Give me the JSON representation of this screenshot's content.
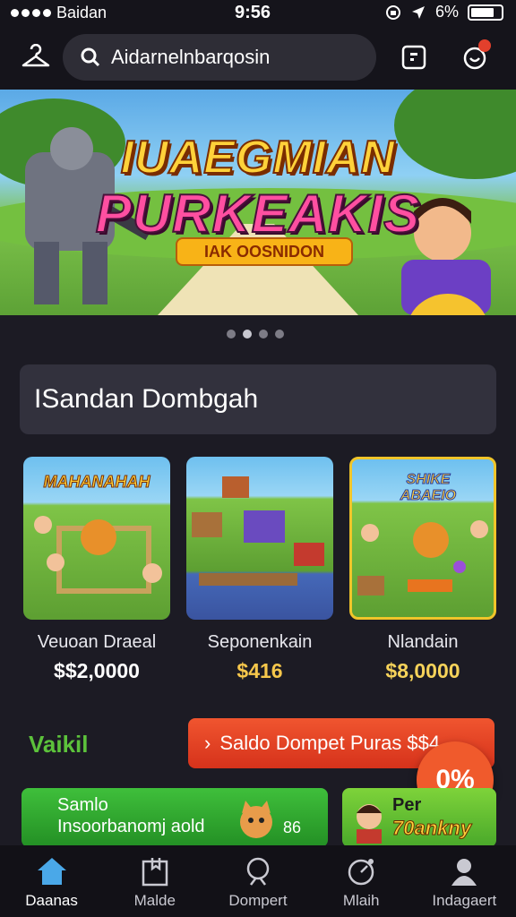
{
  "status_bar": {
    "carrier": "Baidan",
    "time": "9:56",
    "battery": "6%"
  },
  "header": {
    "search_placeholder": "Aidarnelnbarqosin"
  },
  "banner": {
    "title_line1": "IUAEGMIAN",
    "title_line2": "PURKEAKIS",
    "cta_label": "IAK OOSNIDON",
    "slides": 4,
    "active_slide": 2
  },
  "section": {
    "title": "ISandan Dombgah"
  },
  "games": [
    {
      "thumb_title": "MAHANAHAH",
      "name": "Veuoan Draeal",
      "price": "$$2,0000",
      "price_color": "#ffffff"
    },
    {
      "thumb_title": "",
      "name": "Seponenkain",
      "price": "$416",
      "price_color": "#f6c74b"
    },
    {
      "thumb_title": "SHIKE ABAEIO",
      "name": "Nlandain",
      "price": "$8,0000",
      "price_color": "#f6d35a"
    }
  ],
  "wallet": {
    "label": "Vaikil",
    "button_label": "Saldo Dompet Puras $$4",
    "promo_badge": "0%"
  },
  "promos": {
    "left_line1": "Samlo",
    "left_line2": "Insoorbanomj aold",
    "left_count": "86",
    "right_line1": "Per",
    "right_line2": "70ankny"
  },
  "nav": [
    {
      "label": "Daanas",
      "icon": "home-icon",
      "active": true
    },
    {
      "label": "Malde",
      "icon": "bookmark-icon",
      "active": false
    },
    {
      "label": "Dompert",
      "icon": "search-person-icon",
      "active": false
    },
    {
      "label": "Mlaih",
      "icon": "time-icon",
      "active": false
    },
    {
      "label": "Indagaert",
      "icon": "profile-icon",
      "active": false
    }
  ],
  "colors": {
    "background": "#1c1b24",
    "accent_orange": "#e63e22",
    "accent_green": "#3fbf3b",
    "active_nav": "#4aa8e8"
  }
}
